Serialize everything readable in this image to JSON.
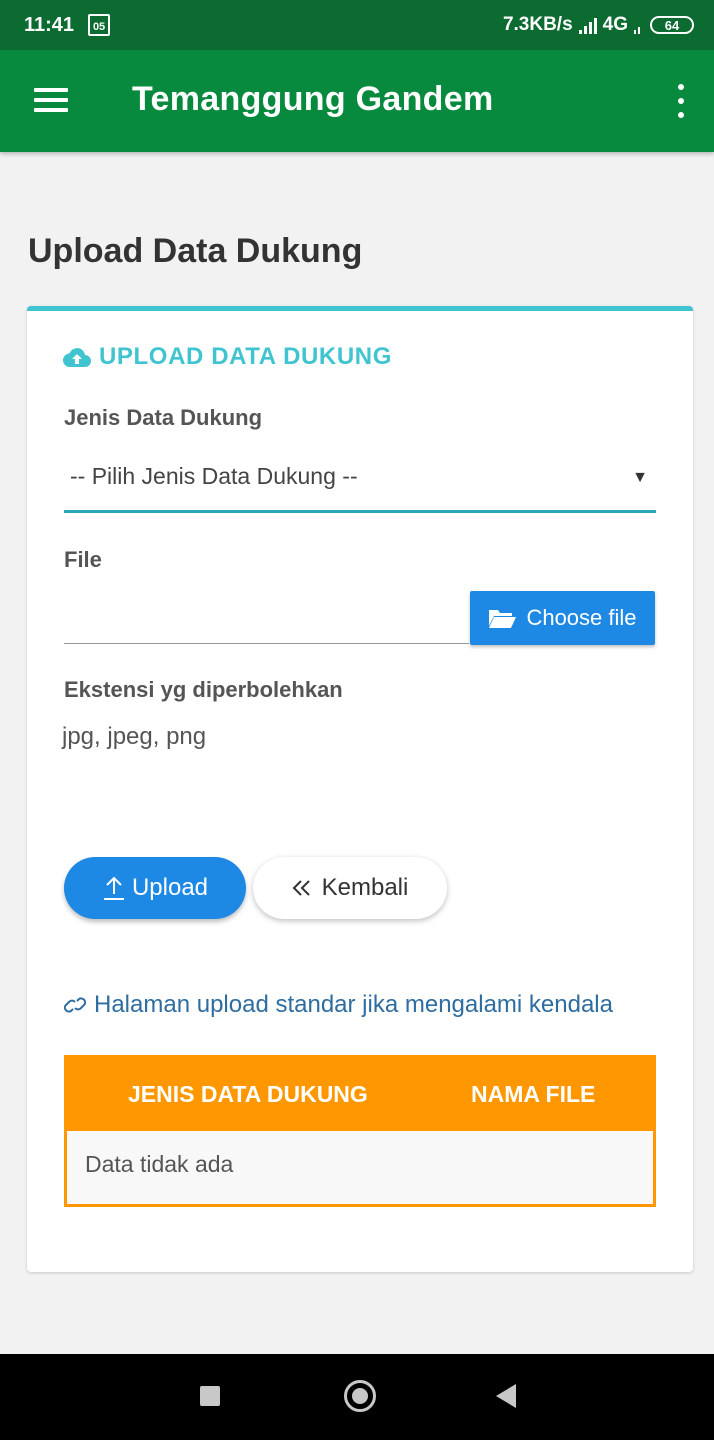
{
  "status_bar": {
    "time": "11:41",
    "sim_label": "05",
    "net_speed": "7.3KB/s",
    "network": "4G",
    "battery": "64"
  },
  "app_bar": {
    "title": "Temanggung Gandem"
  },
  "page": {
    "title": "Upload Data Dukung"
  },
  "card": {
    "header": "UPLOAD DATA DUKUNG",
    "accent_color": "#40c4d0",
    "jenis_label": "Jenis Data Dukung",
    "jenis_select": "-- Pilih Jenis Data Dukung --",
    "file_label": "File",
    "choose_file": "Choose file",
    "ext_label": "Ekstensi yg diperbolehkan",
    "ext_values": "jpg, jpeg, png",
    "upload_button": "Upload",
    "back_button": "Kembali",
    "std_link": "Halaman upload standar jika mengalami kendala"
  },
  "table": {
    "headers": [
      "JENIS DATA DUKUNG",
      "NAMA FILE"
    ],
    "empty_text": "Data tidak ada",
    "header_color": "#ff9800"
  },
  "icons": {
    "menu": "hamburger-icon",
    "more": "kebab-icon",
    "cloud_upload": "cloud-upload-icon",
    "folder": "folder-open-icon",
    "upload": "upload-arrow-icon",
    "back": "double-chevron-left-icon",
    "link": "link-icon"
  }
}
